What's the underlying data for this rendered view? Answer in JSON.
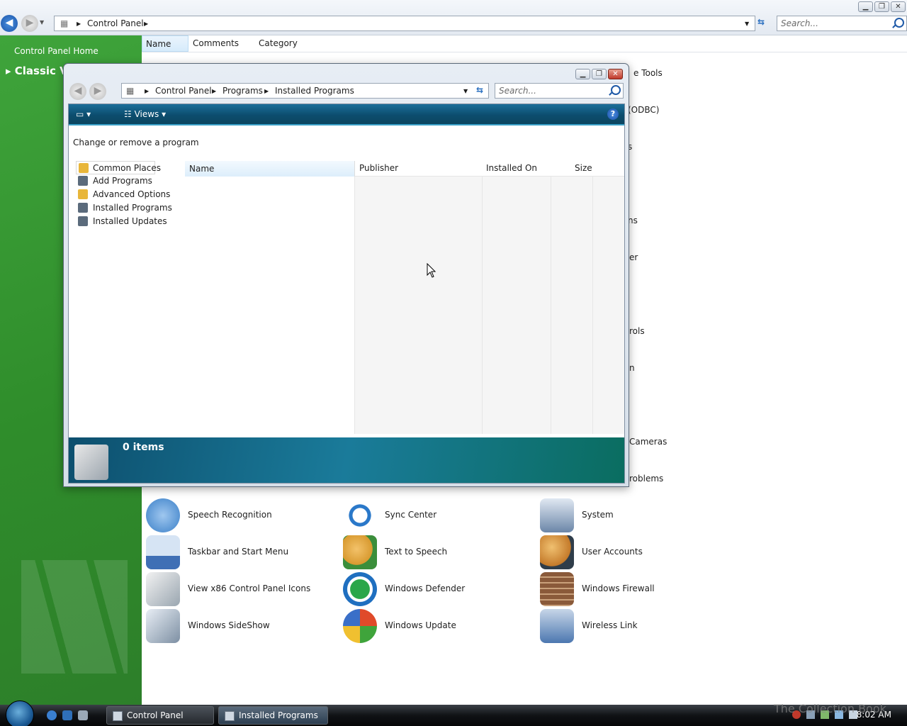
{
  "main_window": {
    "breadcrumb": [
      "Control Panel"
    ],
    "search_placeholder": "Search...",
    "sidebar": {
      "home_link": "Control Panel Home",
      "classic_view": "Classic Vi"
    },
    "columns": [
      "Name",
      "Comments",
      "Category"
    ],
    "items": [
      {
        "label": "Speech Recognition",
        "icon": "microphone-icon",
        "color": "#3a7fc8"
      },
      {
        "label": "Sync Center",
        "icon": "sync-arrows-icon",
        "color": "#2a78c9"
      },
      {
        "label": "System",
        "icon": "computer-check-icon",
        "color": "#6b86a8"
      },
      {
        "label": "Taskbar and Start Menu",
        "icon": "taskbar-icon",
        "color": "#3f6fb5"
      },
      {
        "label": "Text to Speech",
        "icon": "speaking-person-icon",
        "color": "#d89a30"
      },
      {
        "label": "User Accounts",
        "icon": "users-icon",
        "color": "#c47a2a"
      },
      {
        "label": "View x86 Control Panel Icons",
        "icon": "control-panel-icon",
        "color": "#9aa6b0"
      },
      {
        "label": "Windows Defender",
        "icon": "defender-icon",
        "color": "#2aa64a"
      },
      {
        "label": "Windows Firewall",
        "icon": "firewall-icon",
        "color": "#8a5a3a"
      },
      {
        "label": "Windows SideShow",
        "icon": "sideshow-icon",
        "color": "#7d8fa3"
      },
      {
        "label": "Windows Update",
        "icon": "windows-logo-icon",
        "color": "#3a6fc8"
      },
      {
        "label": "Wireless Link",
        "icon": "laptop-icon",
        "color": "#4c77b0"
      }
    ],
    "partial_labels": [
      "e Tools",
      "(ODBC)",
      "s",
      "ns",
      "er",
      "rols",
      "n",
      "Cameras",
      "roblems"
    ]
  },
  "dialog": {
    "breadcrumb": [
      "Control Panel",
      "Programs",
      "Installed Programs"
    ],
    "search_placeholder": "Search...",
    "views_label": "Views",
    "help_label": "?",
    "task_title": "Change or remove a program",
    "places": [
      {
        "label": "Common Places",
        "icon": "folder-icon",
        "color": "#e8b63a"
      },
      {
        "label": "Add Programs",
        "icon": "programs-icon",
        "color": "#5b6b7c"
      },
      {
        "label": "Advanced Options",
        "icon": "folder-icon",
        "color": "#e8b63a"
      },
      {
        "label": "Installed Programs",
        "icon": "programs-icon",
        "color": "#5b6b7c"
      },
      {
        "label": "Installed Updates",
        "icon": "programs-icon",
        "color": "#5b6b7c"
      }
    ],
    "columns": [
      "Name",
      "Publisher",
      "Installed On",
      "Size"
    ],
    "status": {
      "count": "0 items"
    }
  },
  "taskbar": {
    "buttons": [
      "Control Panel",
      "Installed Programs"
    ],
    "clock": "8:02 AM",
    "watermark": "The Collection Book"
  }
}
